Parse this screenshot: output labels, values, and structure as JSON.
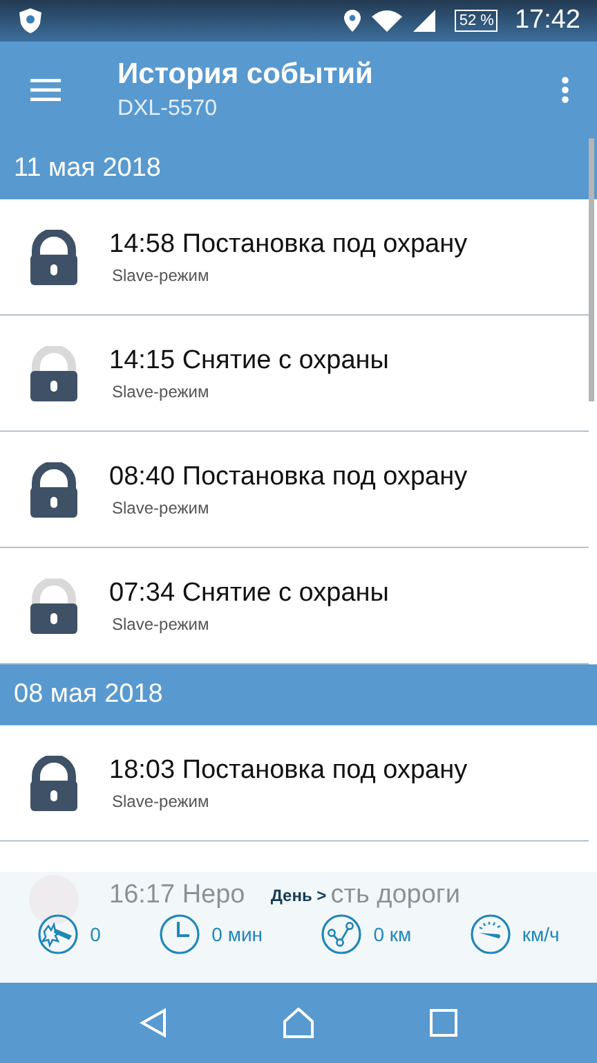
{
  "status_bar": {
    "battery": "52 %",
    "time": "17:42"
  },
  "app_bar": {
    "title": "История событий",
    "subtitle": "DXL-5570"
  },
  "groups": [
    {
      "date": "11 мая 2018",
      "events": [
        {
          "title": "14:58 Постановка под охрану",
          "mode": "Slave-режим",
          "locked": true
        },
        {
          "title": "14:15 Снятие с охраны",
          "mode": "Slave-режим",
          "locked": false
        },
        {
          "title": "08:40 Постановка под охрану",
          "mode": "Slave-режим",
          "locked": true
        },
        {
          "title": "07:34 Снятие с охраны",
          "mode": "Slave-режим",
          "locked": false
        }
      ]
    },
    {
      "date": "08 мая 2018",
      "events": [
        {
          "title": "18:03 Постановка под охрану",
          "mode": "Slave-режим",
          "locked": true
        }
      ]
    }
  ],
  "faded_event": {
    "title_parts": [
      "16:17 Неро",
      "сть дороги"
    ]
  },
  "summary": {
    "period": "День >",
    "stats": [
      {
        "kind": "bumps",
        "value": "0"
      },
      {
        "kind": "time",
        "value": "0 мин"
      },
      {
        "kind": "distance",
        "value": "0 км"
      },
      {
        "kind": "speed",
        "value": "км/ч"
      }
    ]
  }
}
